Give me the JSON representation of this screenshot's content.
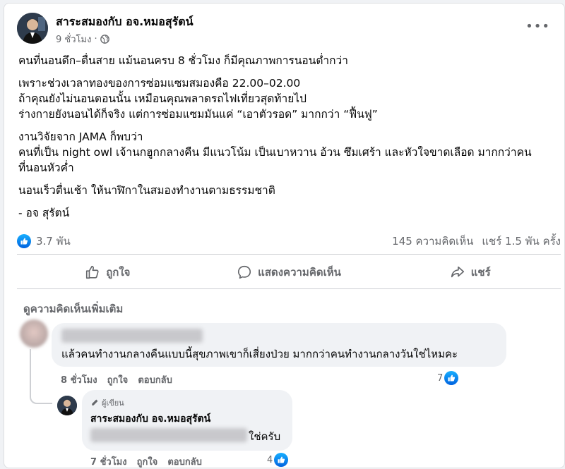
{
  "post": {
    "author": "สาระสมองกับ อจ.หมอสุรัตน์",
    "time": "9 ชั่วโมง",
    "separator": "·",
    "more_icon": "more-icon",
    "paragraphs": [
      [
        "คนที่นอนดึก–ตื่นสาย แม้นอนครบ 8 ชั่วโมง ก็มีคุณภาพการนอนต่ำกว่า"
      ],
      [
        "เพราะช่วงเวลาทองของการซ่อมแซมสมองคือ 22.00–02.00",
        "ถ้าคุณยังไม่นอนตอนนั้น เหมือนคุณพลาดรถไฟเที่ยวสุดท้ายไป",
        "ร่างกายยังนอนได้ก็จริง แต่การซ่อมแซมมันแค่ “เอาตัวรอด” มากกว่า “ฟื้นฟู”"
      ],
      [
        "งานวิจัยจาก JAMA ก็พบว่า",
        "คนที่เป็น night owl เจ้านกฮูกกลางคืน มีแนวโน้ม เป็นเบาหวาน อ้วน ซึมเศร้า และหัวใจขาดเลือด มากกว่าคน",
        "ที่นอนหัวค่ำ"
      ],
      [
        "นอนเร็วตื่นเช้า ให้นาฬิกาในสมองทำงานตามธรรมชาติ"
      ],
      [
        "- อจ สุรัตน์"
      ]
    ]
  },
  "stats": {
    "reactions": "3.7 พัน",
    "comments": "145 ความคิดเห็น",
    "shares": "แชร์ 1.5 พัน ครั้ง"
  },
  "actions": {
    "like": "ถูกใจ",
    "comment": "แสดงความคิดเห็น",
    "share": "แชร์"
  },
  "comments": {
    "see_more": "ดูความคิดเห็นเพิ่มเติม",
    "first": {
      "text": "แล้วคนทำงานกลางคืนแบบนี้สุขภาพเขาก็เสี่ยงป่วย มากกว่าคนทำงานกลางวันใช่ไหมคะ",
      "time": "8 ชั่วโมง",
      "like": "ถูกใจ",
      "reply": "ตอบกลับ",
      "reaction_count": "7"
    },
    "reply": {
      "badge": "ผู้เขียน",
      "author": "สาระสมองกับ อจ.หมอสุรัตน์",
      "text": "ใช่ครับ",
      "time": "7 ชั่วโมง",
      "like": "ถูกใจ",
      "reply": "ตอบกลับ",
      "reaction_count": "4"
    }
  },
  "colors": {
    "accent": "#0866ff",
    "secondary_text": "#65676b"
  }
}
